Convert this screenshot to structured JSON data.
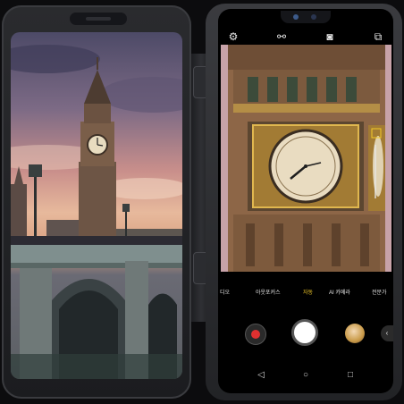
{
  "camera": {
    "modes": [
      "디오",
      "아웃포커스",
      "자동",
      "AI 카메라",
      "전문가"
    ],
    "active_mode": "자동",
    "top_icons": [
      "settings-icon",
      "filter-icon",
      "camera-switch-icon",
      "lens-icon",
      "flip-icon"
    ],
    "accent_color": "#f3c928"
  },
  "navigation": {
    "icons": [
      "back-icon",
      "home-icon",
      "recents-icon"
    ]
  }
}
